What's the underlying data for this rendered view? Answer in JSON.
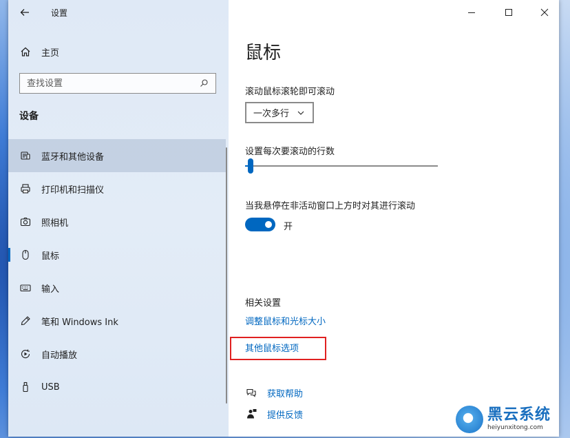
{
  "window": {
    "app_title": "设置"
  },
  "sidebar": {
    "home_label": "主页",
    "search_placeholder": "查找设置",
    "section_heading": "设备",
    "items": [
      {
        "label": "蓝牙和其他设备",
        "icon": "bluetooth-devices-icon"
      },
      {
        "label": "打印机和扫描仪",
        "icon": "printer-icon"
      },
      {
        "label": "照相机",
        "icon": "camera-icon"
      },
      {
        "label": "鼠标",
        "icon": "mouse-icon"
      },
      {
        "label": "输入",
        "icon": "keyboard-icon"
      },
      {
        "label": "笔和 Windows Ink",
        "icon": "pen-icon"
      },
      {
        "label": "自动播放",
        "icon": "autoplay-icon"
      },
      {
        "label": "USB",
        "icon": "usb-icon"
      }
    ]
  },
  "main": {
    "title": "鼠标",
    "scroll_label": "滚动鼠标滚轮即可滚动",
    "scroll_value": "一次多行",
    "lines_label": "设置每次要滚动的行数",
    "inactive_label": "当我悬停在非活动窗口上方时对其进行滚动",
    "toggle_state": "开",
    "related_heading": "相关设置",
    "link_adjust": "调整鼠标和光标大小",
    "link_other": "其他鼠标选项",
    "help": "获取帮助",
    "feedback": "提供反馈"
  },
  "watermark": {
    "brand": "黑云系统",
    "url": "heiyunxitong.com"
  }
}
